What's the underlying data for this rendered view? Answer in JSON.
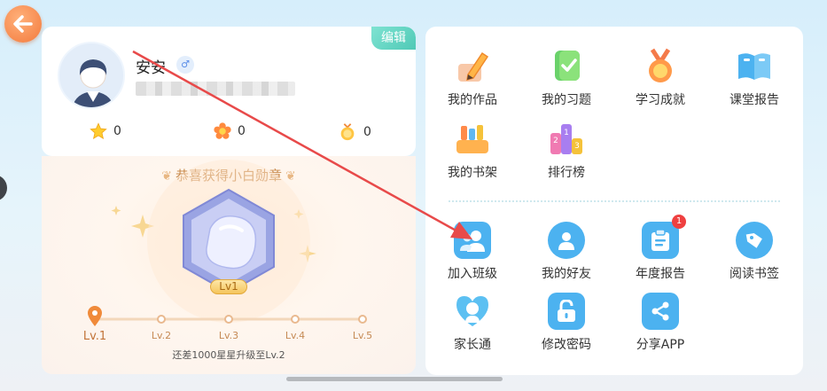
{
  "profile": {
    "edit_label": "编辑",
    "username": "安安",
    "gender_symbol": "♂",
    "stars": "0",
    "flowers": "0",
    "medals": "0"
  },
  "medal": {
    "title": "恭喜获得小白勋章",
    "badge_level": "Lv1",
    "levels": [
      "Lv.1",
      "Lv.2",
      "Lv.3",
      "Lv.4",
      "Lv.5"
    ],
    "current_level_index": 0,
    "progress_text": "还差1000星星升级至Lv.2"
  },
  "menu": {
    "row1": [
      {
        "label": "我的作品",
        "icon": "pencil-icon"
      },
      {
        "label": "我的习题",
        "icon": "exercise-book-icon"
      },
      {
        "label": "学习成就",
        "icon": "medal-icon"
      },
      {
        "label": "课堂报告",
        "icon": "open-book-icon"
      }
    ],
    "row2": [
      {
        "label": "我的书架",
        "icon": "bookshelf-icon"
      },
      {
        "label": "排行榜",
        "icon": "ranking-podium-icon"
      }
    ],
    "row3": [
      {
        "label": "加入班级",
        "icon": "join-class-icon"
      },
      {
        "label": "我的好友",
        "icon": "friend-icon"
      },
      {
        "label": "年度报告",
        "icon": "clipboard-icon",
        "badge": "1"
      },
      {
        "label": "阅读书签",
        "icon": "bookmark-tag-icon"
      }
    ],
    "row4": [
      {
        "label": "家长通",
        "icon": "parent-heart-icon"
      },
      {
        "label": "修改密码",
        "icon": "lock-icon"
      },
      {
        "label": "分享APP",
        "icon": "share-icon"
      }
    ]
  },
  "colors": {
    "accent_orange": "#f37a3c",
    "accent_teal": "#4fc9b6",
    "icon_blue": "#4cb2f0",
    "notification_red": "#ef4040",
    "annotation_arrow": "#e84a4a"
  }
}
